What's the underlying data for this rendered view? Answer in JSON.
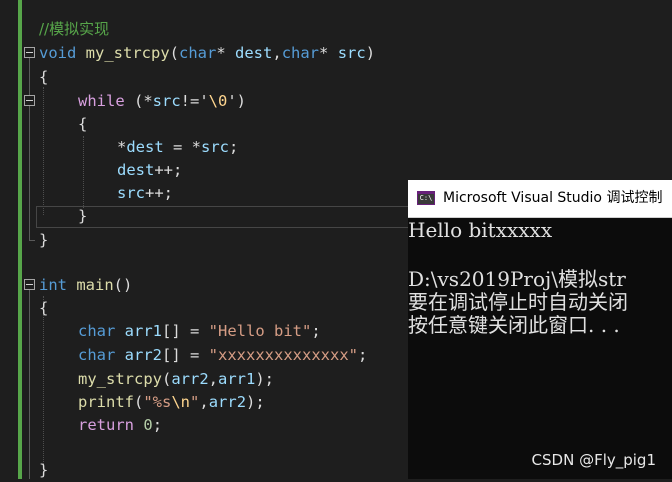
{
  "editor": {
    "comment": "//模拟实现",
    "strcpy_sig": {
      "ret": "void",
      "name": "my_strcpy",
      "p1_type": "char",
      "p1_rest": "* ",
      "p1_name": "dest",
      "comma": ",",
      "p2_type": "char",
      "p2_rest": "* ",
      "p2_name": "src",
      "close": ")"
    },
    "lbrace": "{",
    "rbrace": "}",
    "while_line": {
      "kw": "while",
      "a": " (*",
      "var": "src",
      "b": "!='",
      "esc": "\\0",
      "c": "')"
    },
    "line_dest_assign": {
      "a": "*",
      "dest": "dest",
      "b": " = *",
      "src": "src",
      "c": ";"
    },
    "line_dest_inc": {
      "dest": "dest",
      "rest": "++;"
    },
    "line_src_inc": {
      "src": "src",
      "rest": "++;"
    },
    "main_sig": {
      "ret": "int",
      "name": "main",
      "rest": "()"
    },
    "arr1_line": {
      "type": "char",
      "name": "arr1",
      "mid": "[] = ",
      "str": "\"Hello bit\"",
      "end": ";"
    },
    "arr2_line": {
      "type": "char",
      "name": "arr2",
      "mid": "[] = ",
      "str": "\"xxxxxxxxxxxxxx\"",
      "end": ";"
    },
    "call_line": {
      "fn": "my_strcpy",
      "a": "(",
      "arg1": "arr2",
      "b": ",",
      "arg2": "arr1",
      "c": ");"
    },
    "printf_line": {
      "fn": "printf",
      "a": "(",
      "str": "\"%s",
      "esc": "\\n",
      "str2": "\"",
      "b": ",",
      "arg": "arr2",
      "c": ");"
    },
    "return_line": {
      "kw": "return",
      "sp": " ",
      "num": "0",
      "end": ";"
    }
  },
  "console": {
    "title": "Microsoft Visual Studio 调试控制",
    "icon_text": "C:\\",
    "lines": [
      "Hello bitxxxxx",
      "",
      "D:\\vs2019Proj\\模拟str",
      "要在调试停止时自动关闭",
      "按任意键关闭此窗口. . ."
    ]
  },
  "watermark": "CSDN @Fly_pig1",
  "colors": {
    "background": "#1e1e1e",
    "keyword": "#569cd6",
    "string": "#d69d85",
    "function": "#dcdcaa",
    "comment": "#57a64a"
  }
}
